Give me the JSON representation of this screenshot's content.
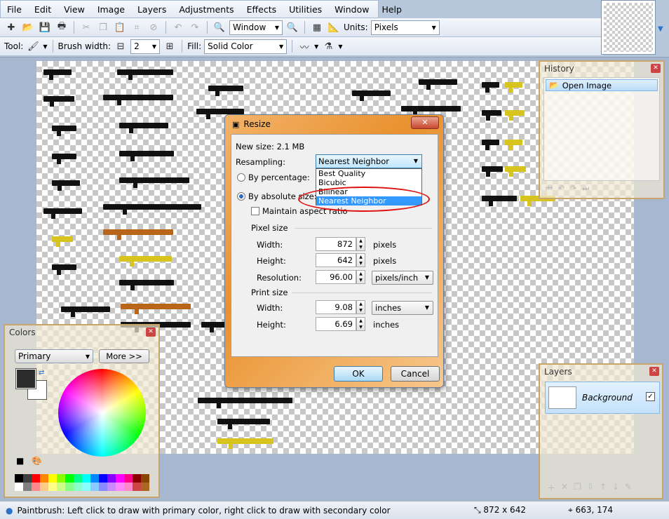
{
  "menu": [
    "File",
    "Edit",
    "View",
    "Image",
    "Layers",
    "Adjustments",
    "Effects",
    "Utilities",
    "Window",
    "Help"
  ],
  "toolbar": {
    "zoom_value": "Window",
    "units_label": "Units:",
    "units_value": "Pixels",
    "tool_label": "Tool:",
    "brush_width_label": "Brush width:",
    "brush_width_value": "2",
    "fill_label": "Fill:",
    "fill_value": "Solid Color"
  },
  "history": {
    "title": "History",
    "item": "Open Image"
  },
  "colors": {
    "title": "Colors",
    "mode": "Primary",
    "more": "More >>",
    "primary_color": "#2c2c2c",
    "secondary_color": "#ffffff"
  },
  "layers": {
    "title": "Layers",
    "layer_name": "Background"
  },
  "dialog": {
    "title": "Resize",
    "new_size": "New size: 2.1 MB",
    "resampling_label": "Resampling:",
    "resampling_value": "Nearest Neighbor",
    "options": [
      "Best Quality",
      "Bicubic",
      "Bilinear",
      "Nearest Neighbor"
    ],
    "by_percentage": "By percentage:",
    "by_absolute": "By absolute size:",
    "maintain": "Maintain aspect ratio",
    "pixel_size": "Pixel size",
    "width_label": "Width:",
    "height_label": "Height:",
    "resolution_label": "Resolution:",
    "print_size": "Print size",
    "px_width": "872",
    "px_height": "642",
    "resolution": "96.00",
    "pixels_unit": "pixels",
    "res_unit": "pixels/inch",
    "print_width": "9.08",
    "print_height": "6.69",
    "print_unit_select": "inches",
    "print_unit": "inches",
    "ok": "OK",
    "cancel": "Cancel"
  },
  "status": {
    "message": "Paintbrush: Left click to draw with primary color, right click to draw with secondary color",
    "image_size": "872 x 642",
    "cursor_pos": "663, 174"
  }
}
